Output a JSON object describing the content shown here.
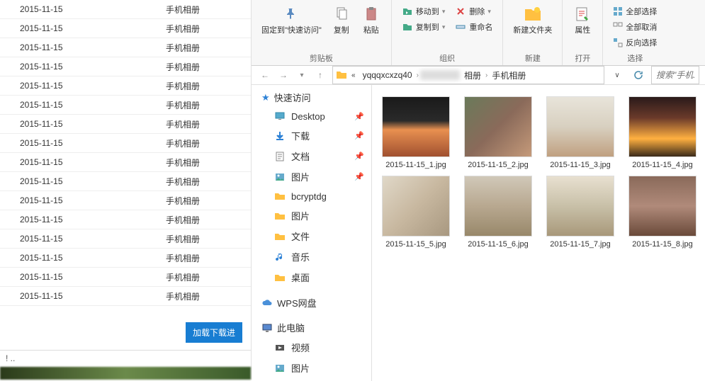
{
  "left_table": {
    "rows": [
      {
        "date": "2015-11-15",
        "type": "手机相册"
      },
      {
        "date": "2015-11-15",
        "type": "手机相册"
      },
      {
        "date": "2015-11-15",
        "type": "手机相册"
      },
      {
        "date": "2015-11-15",
        "type": "手机相册"
      },
      {
        "date": "2015-11-15",
        "type": "手机相册"
      },
      {
        "date": "2015-11-15",
        "type": "手机相册"
      },
      {
        "date": "2015-11-15",
        "type": "手机相册"
      },
      {
        "date": "2015-11-15",
        "type": "手机相册"
      },
      {
        "date": "2015-11-15",
        "type": "手机相册"
      },
      {
        "date": "2015-11-15",
        "type": "手机相册"
      },
      {
        "date": "2015-11-15",
        "type": "手机相册"
      },
      {
        "date": "2015-11-15",
        "type": "手机相册"
      },
      {
        "date": "2015-11-15",
        "type": "手机相册"
      },
      {
        "date": "2015-11-15",
        "type": "手机相册"
      },
      {
        "date": "2015-11-15",
        "type": "手机相册"
      },
      {
        "date": "2015-11-15",
        "type": "手机相册"
      }
    ],
    "load_button": "加载下载进",
    "status": "! .."
  },
  "ribbon": {
    "pin_to_quick": "固定到\"快速访问\"",
    "copy": "复制",
    "paste": "粘贴",
    "clipboard_label": "剪贴板",
    "move_to": "移动到",
    "copy_to": "复制到",
    "delete": "删除",
    "rename": "重命名",
    "organize_label": "组织",
    "new_folder": "新建文件夹",
    "new_label": "新建",
    "properties": "属性",
    "open_label": "打开",
    "select_all": "全部选择",
    "deselect_all": "全部取消",
    "invert_select": "反向选择",
    "select_label": "选择"
  },
  "breadcrumb": {
    "items": [
      "yqqqxcxzq40",
      "相册",
      "手机相册"
    ],
    "search_placeholder": "搜索\"手机..."
  },
  "sidebar": {
    "quick_access": "快速访问",
    "items": [
      {
        "label": "Desktop",
        "icon": "desktop",
        "pinned": true
      },
      {
        "label": "下载",
        "icon": "download",
        "pinned": true
      },
      {
        "label": "文档",
        "icon": "document",
        "pinned": true
      },
      {
        "label": "图片",
        "icon": "pictures",
        "pinned": true
      },
      {
        "label": "bcryptdg",
        "icon": "folder",
        "pinned": false
      },
      {
        "label": "图片",
        "icon": "folder",
        "pinned": false
      },
      {
        "label": "文件",
        "icon": "folder",
        "pinned": false
      },
      {
        "label": "音乐",
        "icon": "music",
        "pinned": false
      },
      {
        "label": "桌面",
        "icon": "folder",
        "pinned": false
      }
    ],
    "wps_cloud": "WPS网盘",
    "this_pc": "此电脑",
    "videos": "视频",
    "pictures": "图片"
  },
  "thumbs": [
    {
      "label": "2015-11-15_1.jpg",
      "bg": "linear-gradient(#1a1a1a 0%, #2a2a2a 40%, #e89050 55%, #a05030 100%)"
    },
    {
      "label": "2015-11-15_2.jpg",
      "bg": "linear-gradient(135deg,#6a7a5a,#8a6a5a,#c59a7a)"
    },
    {
      "label": "2015-11-15_3.jpg",
      "bg": "linear-gradient(#e8e4da,#d8d0c0,#c0a080)"
    },
    {
      "label": "2015-11-15_4.jpg",
      "bg": "linear-gradient(#2a1a1a,#6a3a2a,#ffb040 70%,#3a2a1a)"
    },
    {
      "label": "2015-11-15_5.jpg",
      "bg": "linear-gradient(135deg,#e0d8c8,#c8b8a0,#a89880)"
    },
    {
      "label": "2015-11-15_6.jpg",
      "bg": "linear-gradient(#d0c8b8,#b8a890,#98886a)"
    },
    {
      "label": "2015-11-15_7.jpg",
      "bg": "linear-gradient(#e8e0d0,#c8c0a8,#a8987a)"
    },
    {
      "label": "2015-11-15_8.jpg",
      "bg": "linear-gradient(#8a6a5a,#b08a7a,#6a4a3a)"
    }
  ]
}
